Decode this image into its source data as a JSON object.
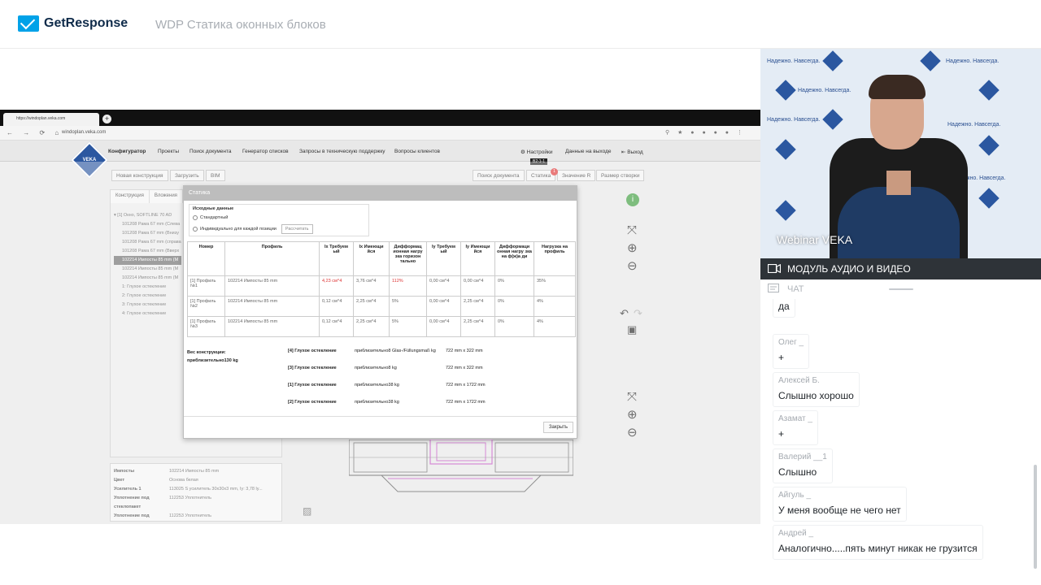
{
  "header": {
    "brand": "GetResponse",
    "webinar_title": "WDP Статика оконных блоков"
  },
  "browser": {
    "tab_title": "https://windoplan.veka.com",
    "url": "windoplan.veka.com",
    "nav_icons": "← → ⟳ ⌂"
  },
  "app": {
    "logo": "VEKA",
    "nav": [
      "Конфигуратор",
      "Проекты",
      "Поиск документа",
      "Генератор списков",
      "Запросы в техническую поддержку",
      "Вопросы клиентов"
    ],
    "nav_right": [
      "⚙ Настройки",
      "Данные на выходе",
      "⇤ Выход"
    ],
    "toolbar_left": [
      "Новая конструкция",
      "Загрузить",
      "BIM"
    ],
    "toolbar_right": [
      "Поиск документа",
      "Статика",
      "Значение R",
      "Размер створки"
    ],
    "tooltip": "В2-1-1",
    "badge": "1",
    "left_tabs": [
      "Конструкция",
      "Вложения"
    ],
    "tree": [
      "▾ [1] Окно, SOFTLINE 70 AD",
      "101208 Рама 67 mm (Слева",
      "101208 Рама 67 mm (Внизу",
      "101208 Рама 67 mm (справа",
      "101208 Рама 67 mm (Вверх",
      "102214 Импосты 85 mm (М",
      "102214 Импосты 85 mm (М",
      "102214 Импосты 85 mm (М",
      "1: Глухое остекление",
      "2: Глухое остекление",
      "3: Глухое остекление",
      "4: Глухое остекление"
    ],
    "properties": [
      {
        "k": "Импосты",
        "v": "102214 Импосты 85 mm"
      },
      {
        "k": "Цвет",
        "v": "Основа белая"
      },
      {
        "k": "Усилитель 1",
        "v": "113025 S усилитель 30x30x3 mm, Iy: 3,78 ly..."
      },
      {
        "k": "Уплотнение под стеклопакет",
        "v": "112253 Уплотнитель"
      },
      {
        "k": "Уплотнение под",
        "v": "112253 Уплотнитель"
      }
    ]
  },
  "modal": {
    "title": "Статика",
    "initial_data_label": "Исходные данные",
    "option_standard": "Стандартный",
    "option_individual": "Индивидуально для каждой позиции",
    "calc_button": "Рассчитать",
    "columns": [
      "Номер",
      "Профиль",
      "Ix Требуем ый",
      "Ix Имеющи йся",
      "Дифформац ионная нагру зка горизон тально",
      "Iy Требуем ый",
      "Iy Имеющи йся",
      "Дифформаци онная нагру зка на ф(ж)а ди",
      "Нагрузка на профиль"
    ],
    "rows": [
      [
        "[1] Профиль №1",
        "102214 Импосты 85 mm",
        "4,23 cм^4",
        "3,76 cм^4",
        "112%",
        "0,00 cм^4",
        "0,00 cм^4",
        "0%",
        "35%"
      ],
      [
        "[1] Профиль №2",
        "102214 Импосты 85 mm",
        "0,12 cм^4",
        "2,25 cм^4",
        "5%",
        "0,00 cм^4",
        "2,25 cм^4",
        "0%",
        "4%"
      ],
      [
        "[1] Профиль №3",
        "102214 Импосты 85 mm",
        "0,12 cм^4",
        "2,25 cм^4",
        "5%",
        "0,00 cм^4",
        "2,25 cм^4",
        "0%",
        "4%"
      ]
    ],
    "weight_label": "Вес конструкции:",
    "weight_value": "приблизительно130 kg",
    "glazing": [
      {
        "name": "[4] Глухое остекление",
        "weight": "приблизительно8 Glas-/Füllungsmaß kg",
        "size": "722 mm x 322 mm"
      },
      {
        "name": "[3] Глухое остекление",
        "weight": "приблизительно8 kg",
        "size": "722 mm x 322 mm"
      },
      {
        "name": "[1] Глухое остекление",
        "weight": "приблизительно38 kg",
        "size": "722 mm x 1722 mm"
      },
      {
        "name": "[2] Глухое остекление",
        "weight": "приблизительно38 kg",
        "size": "722 mm x 1722 mm"
      }
    ],
    "close_button": "Закрыть"
  },
  "video": {
    "label": "Webinar VEKA",
    "backdrop_text": "Надежно. Навсегда."
  },
  "panels": {
    "module_label": "МОДУЛЬ АУДИО И ВИДЕО",
    "chat_label": "ЧАТ"
  },
  "chat": [
    {
      "name": "",
      "text": "да"
    },
    {
      "name": "Олег _",
      "text": "+"
    },
    {
      "name": "Алексей Б.",
      "text": "Слышно хорошо"
    },
    {
      "name": "Азамат _",
      "text": "+"
    },
    {
      "name": "Валерий __1",
      "text": "Слышно"
    },
    {
      "name": "Айгуль _",
      "text": "У меня вообще не чего нет"
    },
    {
      "name": "Андрей _",
      "text": "Аналогично.....пять минут никак не грузится"
    }
  ],
  "colors": {
    "brand": "#00a2e8",
    "veka_blue": "#2b57a0",
    "module_bar": "#2e3338",
    "warning_red": "#dd3333"
  }
}
